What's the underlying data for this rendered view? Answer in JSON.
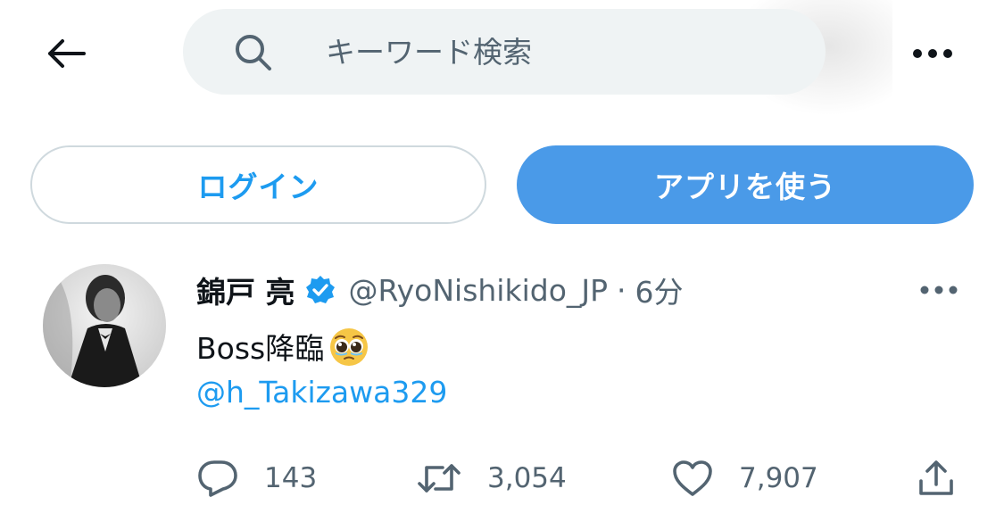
{
  "topbar": {
    "back_icon": "arrow-left-icon",
    "search_placeholder": "キーワード検索",
    "more_icon": "more-horizontal-icon"
  },
  "buttons": {
    "login_label": "ログイン",
    "app_label": "アプリを使う"
  },
  "colors": {
    "accent": "#1d9bf0",
    "app_button_bg": "#4a9ae8",
    "search_bg": "#eff3f4",
    "secondary_text": "#536471"
  },
  "tweet": {
    "display_name": "錦戸 亮",
    "verified_icon": "verified-badge-icon",
    "handle": "@RyoNishikido_JP",
    "separator": "·",
    "time": "6分",
    "text": "Boss降臨",
    "emoji": "pleading-face-emoji",
    "mention": "@h_Takizawa329",
    "actions": {
      "reply_count": "143",
      "retweet_count": "3,054",
      "like_count": "7,907"
    }
  }
}
